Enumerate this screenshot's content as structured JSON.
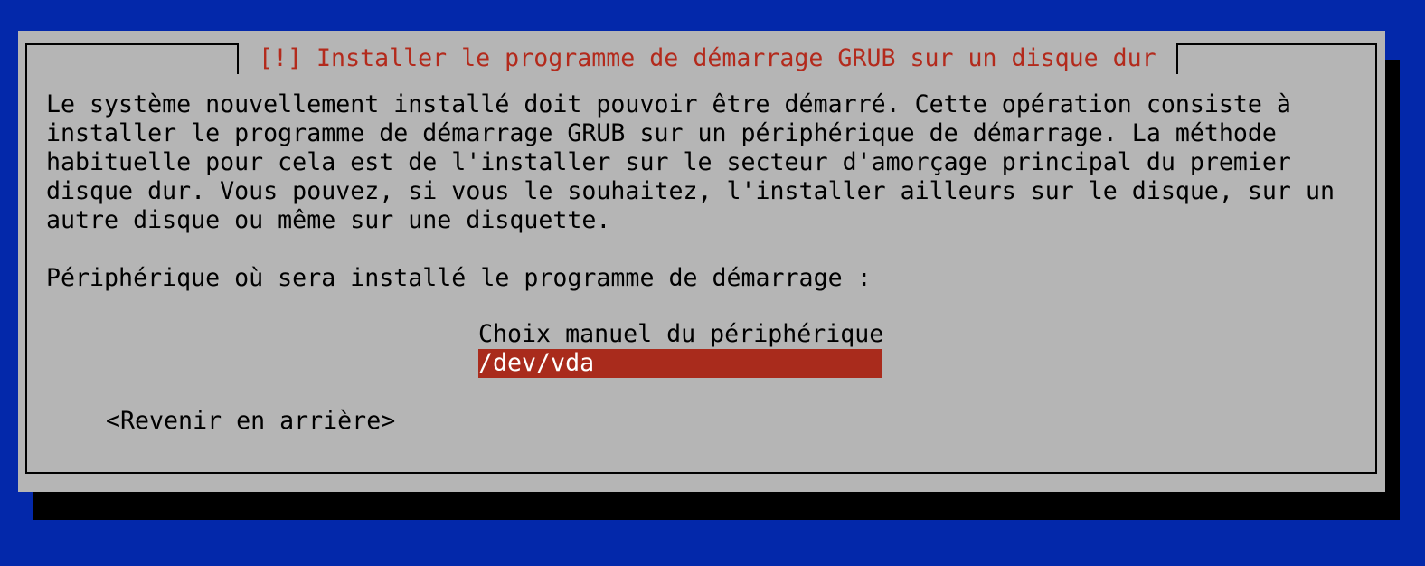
{
  "dialog": {
    "title": "[!] Installer le programme de démarrage GRUB sur un disque dur",
    "description_lines": [
      "Le système nouvellement installé doit pouvoir être démarré. Cette opération consiste à",
      "installer le programme de démarrage GRUB sur un périphérique de démarrage. La méthode",
      "habituelle pour cela est de l'installer sur le secteur d'amorçage principal du premier",
      "disque dur. Vous pouvez, si vous le souhaitez, l'installer ailleurs sur le disque, sur un",
      "autre disque ou même sur une disquette."
    ],
    "prompt": "Périphérique où sera installé le programme de démarrage :",
    "options": [
      {
        "label": "Choix manuel du périphérique",
        "selected": false
      },
      {
        "label": "/dev/vda",
        "selected": true
      }
    ],
    "back_button": "<Revenir en arrière>"
  },
  "colors": {
    "background": "#0328aa",
    "dialog": "#b5b5b5",
    "title_text": "#b32a1c",
    "selection": "#a92b1c"
  }
}
